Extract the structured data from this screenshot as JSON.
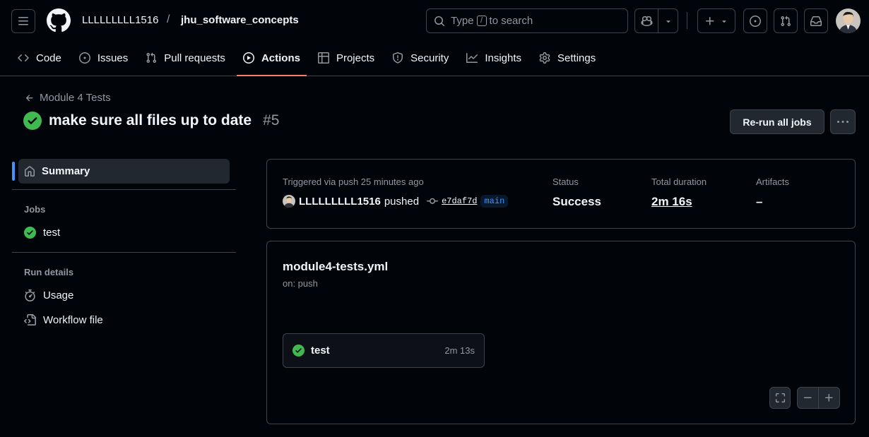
{
  "header": {
    "owner": "LLLLLLLLL1516",
    "separator": "/",
    "repo": "jhu_software_concepts",
    "search_prefix": "Type",
    "search_key": "/",
    "search_suffix": "to search"
  },
  "tabs": [
    {
      "label": "Code",
      "icon": "code-icon"
    },
    {
      "label": "Issues",
      "icon": "issue-icon"
    },
    {
      "label": "Pull requests",
      "icon": "pull-request-icon"
    },
    {
      "label": "Actions",
      "icon": "play-icon",
      "active": true
    },
    {
      "label": "Projects",
      "icon": "table-icon"
    },
    {
      "label": "Security",
      "icon": "shield-icon"
    },
    {
      "label": "Insights",
      "icon": "graph-icon"
    },
    {
      "label": "Settings",
      "icon": "gear-icon"
    }
  ],
  "run": {
    "back_label": "Module 4 Tests",
    "title": "make sure all files up to date",
    "number": "#5",
    "rerun_label": "Re-run all jobs"
  },
  "sidebar": {
    "summary": "Summary",
    "jobs_heading": "Jobs",
    "job": "test",
    "run_details_heading": "Run details",
    "usage": "Usage",
    "workflow_file": "Workflow file"
  },
  "summary": {
    "trigger": "Triggered via push 25 minutes ago",
    "actor": "LLLLLLLLL1516",
    "pushed": "pushed",
    "sha": "e7daf7d",
    "branch": "main",
    "status_label": "Status",
    "status": "Success",
    "duration_label": "Total duration",
    "duration": "2m 16s",
    "artifacts_label": "Artifacts",
    "artifacts": "–"
  },
  "workflow": {
    "file": "module4-tests.yml",
    "on": "on: push",
    "job_name": "test",
    "job_duration": "2m 13s"
  },
  "colors": {
    "success": "#3fb950",
    "accent_underline": "#f78166",
    "link": "#4493f8"
  }
}
